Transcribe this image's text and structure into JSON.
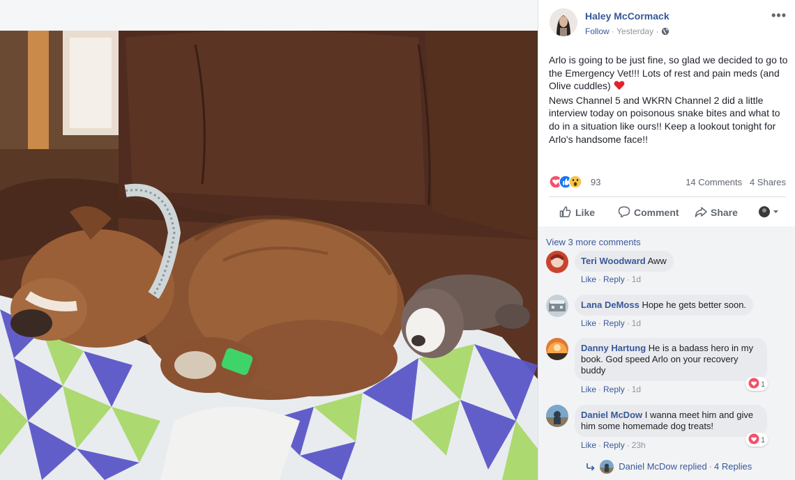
{
  "post": {
    "author": "Haley McCormack",
    "follow_label": "Follow",
    "separator": "·",
    "time": "Yesterday",
    "more_label": "•••",
    "text_lines": [
      "Arlo is going to be just fine, so glad we decided to go to the Emergency Vet!!! Lots of rest and pain meds (and Olive cuddles)",
      "News Channel 5 and WKRN Channel 2 did a little interview today on poisonous snake bites and what to do in a situation like ours!! Keep a lookout tonight for Arlo's handsome face!!"
    ],
    "reactions": {
      "icons": [
        "love-reaction",
        "like-reaction",
        "wow-reaction"
      ],
      "count": "93"
    },
    "comments_count": "14 Comments",
    "shares_count": "4 Shares",
    "actions": {
      "like": "Like",
      "comment": "Comment",
      "share": "Share"
    }
  },
  "comments": {
    "view_more": "View 3 more comments",
    "items": [
      {
        "name": "Teri Woodward",
        "text": "Aww",
        "like": "Like",
        "reply": "Reply",
        "time": "1d"
      },
      {
        "name": "Lana DeMoss",
        "text": "Hope he gets better soon.",
        "like": "Like",
        "reply": "Reply",
        "time": "1d"
      },
      {
        "name": "Danny Hartung",
        "text": "He is a badass hero in my book. God speed Arlo on your recovery buddy",
        "like": "Like",
        "reply": "Reply",
        "time": "1d",
        "reaction_count": "1"
      },
      {
        "name": "Daniel McDow",
        "text": "I wanna meet him and give him some homemade dog treats!",
        "like": "Like",
        "reply": "Reply",
        "time": "23h",
        "reaction_count": "1"
      }
    ],
    "replied": {
      "text": "Daniel McDow replied",
      "sep": "·",
      "count": "4 Replies"
    }
  },
  "colors": {
    "link_blue": "#385898",
    "name_blue": "#365899",
    "love_red": "#f25268",
    "like_blue": "#1877f2"
  }
}
